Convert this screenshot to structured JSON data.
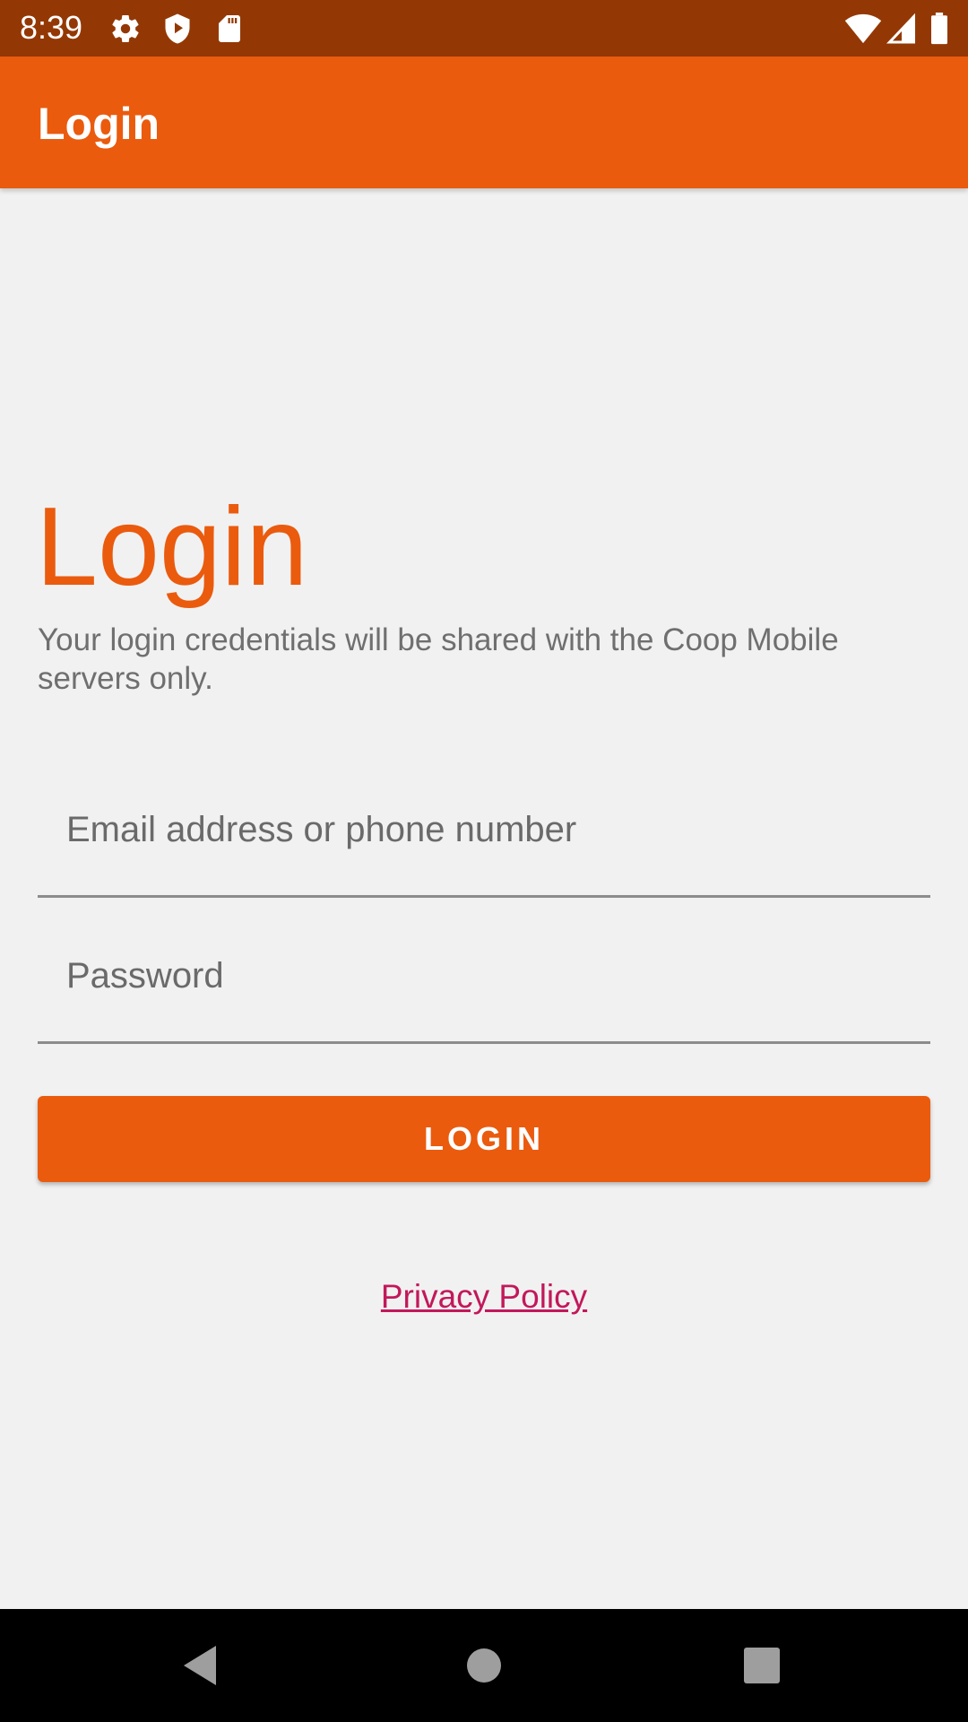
{
  "status_bar": {
    "time": "8:39",
    "icons": [
      "gear-icon",
      "shield-play-icon",
      "sd-card-icon",
      "wifi-icon",
      "signal-icon",
      "battery-icon"
    ],
    "color": "#933805"
  },
  "app_bar": {
    "title": "Login",
    "color": "#ea5b0e"
  },
  "main": {
    "heading": "Login",
    "subtitle": "Your login credentials will be shared with the Coop Mobile servers only.",
    "email_field": {
      "placeholder": "Email address or phone number",
      "value": ""
    },
    "password_field": {
      "placeholder": "Password",
      "value": ""
    },
    "login_button_label": "LOGIN",
    "privacy_link": "Privacy Policy"
  },
  "colors": {
    "accent": "#ea5b0e",
    "link": "#c2185b",
    "background": "#f1f1f1"
  },
  "nav_bar": {
    "buttons": [
      "back-icon",
      "home-icon",
      "recents-icon"
    ]
  }
}
